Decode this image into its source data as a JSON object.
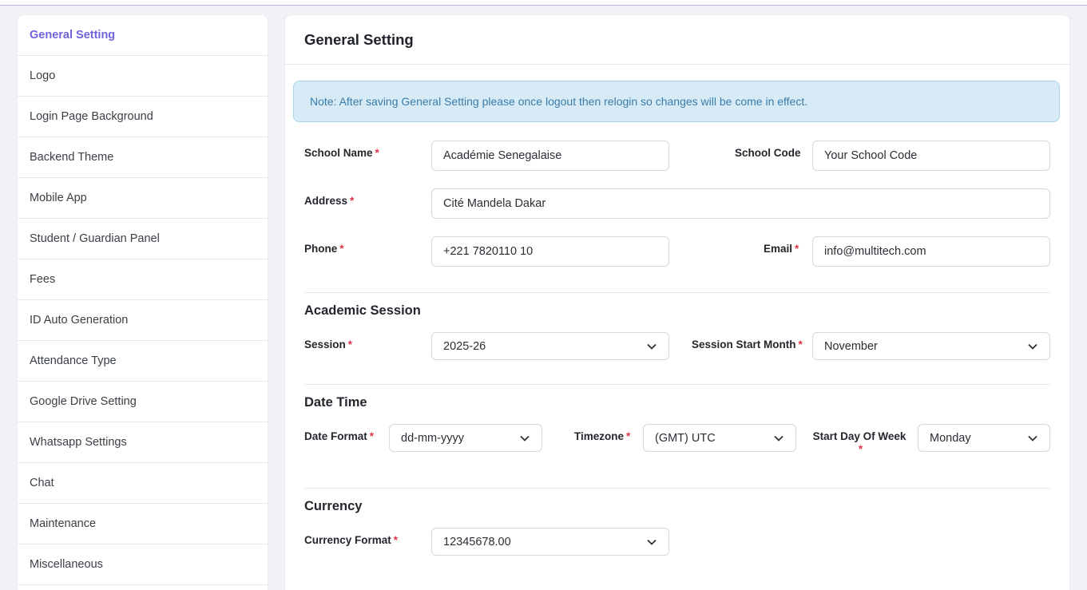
{
  "sidebar": {
    "items": [
      {
        "label": "General Setting",
        "active": true
      },
      {
        "label": "Logo"
      },
      {
        "label": "Login Page Background"
      },
      {
        "label": "Backend Theme"
      },
      {
        "label": "Mobile App"
      },
      {
        "label": "Student / Guardian Panel"
      },
      {
        "label": "Fees"
      },
      {
        "label": "ID Auto Generation"
      },
      {
        "label": "Attendance Type"
      },
      {
        "label": "Google Drive Setting"
      },
      {
        "label": "Whatsapp Settings"
      },
      {
        "label": "Chat"
      },
      {
        "label": "Maintenance"
      },
      {
        "label": "Miscellaneous"
      }
    ]
  },
  "panel": {
    "title": "General Setting",
    "note": "Note: After saving General Setting please once logout then relogin so changes will be come in effect."
  },
  "form": {
    "school_name": {
      "label": "School Name",
      "value": "Académie Senegalaise"
    },
    "school_code": {
      "label": "School Code",
      "value": "Your School Code"
    },
    "address": {
      "label": "Address",
      "value": "Cité Mandela Dakar"
    },
    "phone": {
      "label": "Phone",
      "value": "+221 7820110 10"
    },
    "email": {
      "label": "Email",
      "value": "info@multitech.com"
    }
  },
  "academic": {
    "heading": "Academic Session",
    "session": {
      "label": "Session",
      "value": "2025-26"
    },
    "start_month": {
      "label": "Session Start Month",
      "value": "November"
    }
  },
  "datetime": {
    "heading": "Date Time",
    "date_format": {
      "label": "Date Format",
      "value": "dd-mm-yyyy"
    },
    "timezone": {
      "label": "Timezone",
      "value": "(GMT) UTC"
    },
    "start_day": {
      "label": "Start Day Of Week",
      "value": "Monday"
    }
  },
  "currency": {
    "heading": "Currency",
    "format": {
      "label": "Currency Format",
      "value": "12345678.00"
    }
  },
  "required_mark": "*",
  "colors": {
    "accent": "#7063db",
    "required": "#e0344a",
    "note_bg": "#d7ebf7",
    "note_text": "#3a7ca8"
  }
}
